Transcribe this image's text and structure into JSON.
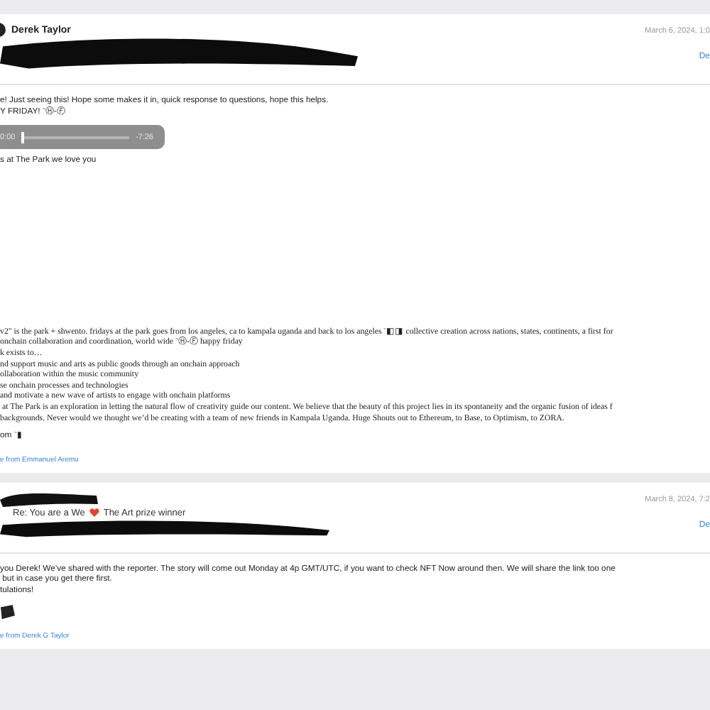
{
  "messages": [
    {
      "sender": "Derek Taylor",
      "date": "March 6, 2024, 1:0",
      "action": "De",
      "header_redacted": true,
      "blocks": [
        {
          "kind": "text",
          "lines": [
            "e! Just seeing this! Hope some makes it in, quick response to questions, hope this helps.",
            "Y FRIDAY! ⁻Ⓗ-Ⓕ"
          ]
        },
        {
          "kind": "audio",
          "elapsed": "0:00",
          "remaining": "-7:26",
          "level": 0
        },
        {
          "kind": "text",
          "lines": [
            "s at The Park we love you"
          ]
        },
        {
          "kind": "serif",
          "lines": [
            "v2\" is the park + shwento. fridays at the park goes from los angeles, ca to kampala uganda and back to los angeles ⁻◧◨ collective creation across nations, states, continents, a first for",
            "onchain collaboration and coordination, world wide ⁻Ⓗ-Ⓕ happy friday",
            "k exists to…",
            "nd support music and arts as public goods through an onchain approach",
            "ollaboration within the music community",
            "se onchain processes and technologies",
            "and motivate a new wave of artists to engage with onchain platforms",
            " at The Park is an exploration in letting the natural flow of creativity guide our content. We believe that the beauty of this project lies in its spontaneity and the organic fusion of ideas f",
            "backgrounds. Never would we thought we’d be creating with a team of new friends in Kampala Uganda. Huge Shouts out to Ethereum, to Base, to Optimism, to ZORA."
          ]
        },
        {
          "kind": "text",
          "lines": [
            "om ⁻▮"
          ]
        },
        {
          "kind": "link",
          "text": "e from Emmanuel Aremu"
        }
      ]
    },
    {
      "date": "March 8, 2024, 7:2",
      "action": "De",
      "header_redacted": true,
      "subject": {
        "before": "Re: You are a We",
        "after": "The Art prize winner"
      },
      "blocks": [
        {
          "kind": "text",
          "lines": [
            "you Derek! We’ve shared with the reporter. The story will come out Monday at 4p GMT/UTC, if you want to check NFT Now around then. We will share the link too one",
            " but in case you get there first.",
            "tulations!"
          ]
        },
        {
          "kind": "redacted"
        },
        {
          "kind": "link",
          "text": "e from Derek G Taylor"
        }
      ]
    }
  ]
}
